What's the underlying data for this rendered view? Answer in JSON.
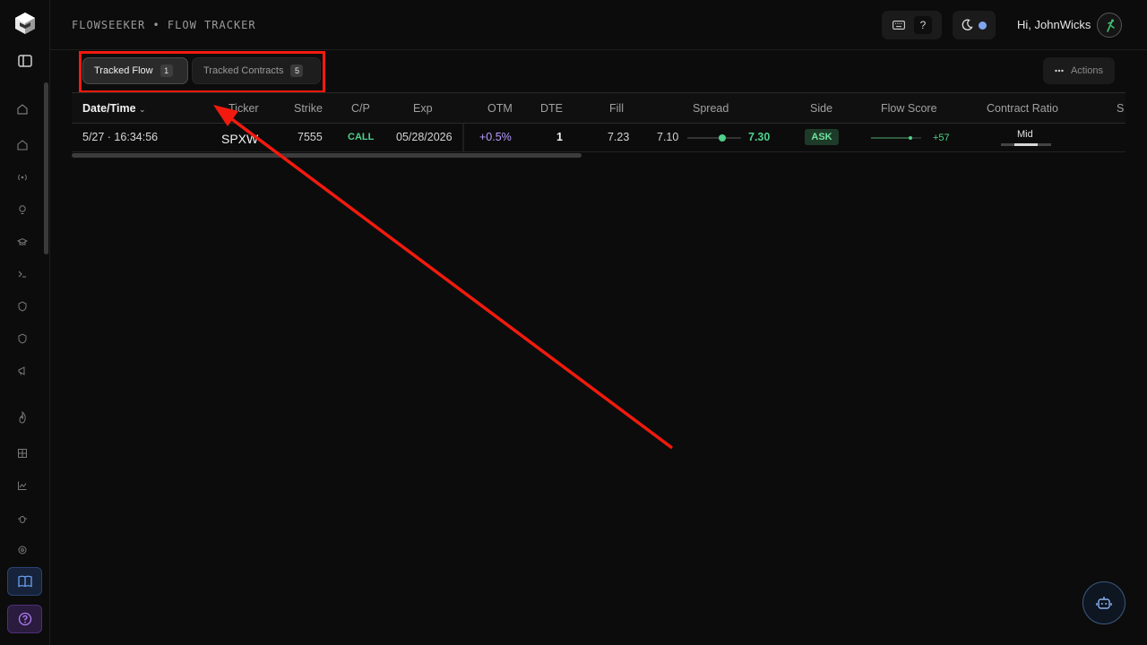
{
  "header": {
    "breadcrumb": "FLOWSEEKER • FLOW TRACKER",
    "shortcut_label": "?",
    "greeting": "Hi, JohnWicks"
  },
  "tabs": [
    {
      "label": "Tracked Flow",
      "count": "1",
      "active": true
    },
    {
      "label": "Tracked Contracts",
      "count": "5",
      "active": false
    }
  ],
  "actions_label": "Actions",
  "table": {
    "columns": [
      "Date/Time",
      "Ticker",
      "Strike",
      "C/P",
      "Exp",
      "OTM",
      "DTE",
      "Fill",
      "Spread",
      "Side",
      "Flow Score",
      "Contract Ratio",
      "S"
    ],
    "rows": [
      {
        "datetime": "5/27 · 16:34:56",
        "ticker": "SPXW",
        "strike": "7555",
        "cp": "CALL",
        "exp": "05/28/2026",
        "otm": "+0.5%",
        "dte": "1",
        "fill": "7.23",
        "bid": "7.10",
        "ask": "7.30",
        "spread_position": 0.65,
        "side": "ASK",
        "flow_score": "+57",
        "flow_score_level": 0.78,
        "contract_ratio": "Mid",
        "contract_ratio_level": 0.5
      }
    ]
  },
  "sidebar": {
    "icons": [
      "logo-icon",
      "sidebar-toggle-icon",
      "home-icon",
      "home-alt-icon",
      "broadcast-icon",
      "lightbulb-icon",
      "graduation-cap-icon",
      "terminal-icon",
      "shield-icon",
      "shield-alt-icon",
      "megaphone-icon",
      "flame-icon",
      "grid-icon",
      "line-chart-icon",
      "bug-icon",
      "settings-icon",
      "book-icon",
      "help-icon"
    ]
  },
  "colors": {
    "accent_green": "#4fd08b",
    "otm_purple": "#b89cff",
    "annotation_red": "#f21a0e",
    "theme_dot": "#7ea6f0"
  }
}
